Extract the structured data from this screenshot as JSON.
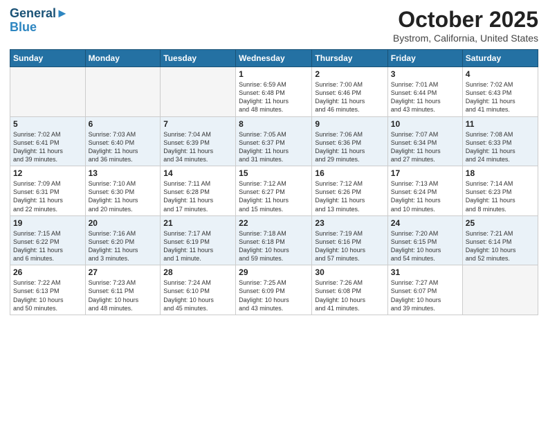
{
  "header": {
    "logo_line1": "General",
    "logo_line2": "Blue",
    "month_title": "October 2025",
    "location": "Bystrom, California, United States"
  },
  "days_of_week": [
    "Sunday",
    "Monday",
    "Tuesday",
    "Wednesday",
    "Thursday",
    "Friday",
    "Saturday"
  ],
  "weeks": [
    [
      {
        "day": "",
        "info": ""
      },
      {
        "day": "",
        "info": ""
      },
      {
        "day": "",
        "info": ""
      },
      {
        "day": "1",
        "info": "Sunrise: 6:59 AM\nSunset: 6:48 PM\nDaylight: 11 hours\nand 48 minutes."
      },
      {
        "day": "2",
        "info": "Sunrise: 7:00 AM\nSunset: 6:46 PM\nDaylight: 11 hours\nand 46 minutes."
      },
      {
        "day": "3",
        "info": "Sunrise: 7:01 AM\nSunset: 6:44 PM\nDaylight: 11 hours\nand 43 minutes."
      },
      {
        "day": "4",
        "info": "Sunrise: 7:02 AM\nSunset: 6:43 PM\nDaylight: 11 hours\nand 41 minutes."
      }
    ],
    [
      {
        "day": "5",
        "info": "Sunrise: 7:02 AM\nSunset: 6:41 PM\nDaylight: 11 hours\nand 39 minutes."
      },
      {
        "day": "6",
        "info": "Sunrise: 7:03 AM\nSunset: 6:40 PM\nDaylight: 11 hours\nand 36 minutes."
      },
      {
        "day": "7",
        "info": "Sunrise: 7:04 AM\nSunset: 6:39 PM\nDaylight: 11 hours\nand 34 minutes."
      },
      {
        "day": "8",
        "info": "Sunrise: 7:05 AM\nSunset: 6:37 PM\nDaylight: 11 hours\nand 31 minutes."
      },
      {
        "day": "9",
        "info": "Sunrise: 7:06 AM\nSunset: 6:36 PM\nDaylight: 11 hours\nand 29 minutes."
      },
      {
        "day": "10",
        "info": "Sunrise: 7:07 AM\nSunset: 6:34 PM\nDaylight: 11 hours\nand 27 minutes."
      },
      {
        "day": "11",
        "info": "Sunrise: 7:08 AM\nSunset: 6:33 PM\nDaylight: 11 hours\nand 24 minutes."
      }
    ],
    [
      {
        "day": "12",
        "info": "Sunrise: 7:09 AM\nSunset: 6:31 PM\nDaylight: 11 hours\nand 22 minutes."
      },
      {
        "day": "13",
        "info": "Sunrise: 7:10 AM\nSunset: 6:30 PM\nDaylight: 11 hours\nand 20 minutes."
      },
      {
        "day": "14",
        "info": "Sunrise: 7:11 AM\nSunset: 6:28 PM\nDaylight: 11 hours\nand 17 minutes."
      },
      {
        "day": "15",
        "info": "Sunrise: 7:12 AM\nSunset: 6:27 PM\nDaylight: 11 hours\nand 15 minutes."
      },
      {
        "day": "16",
        "info": "Sunrise: 7:12 AM\nSunset: 6:26 PM\nDaylight: 11 hours\nand 13 minutes."
      },
      {
        "day": "17",
        "info": "Sunrise: 7:13 AM\nSunset: 6:24 PM\nDaylight: 11 hours\nand 10 minutes."
      },
      {
        "day": "18",
        "info": "Sunrise: 7:14 AM\nSunset: 6:23 PM\nDaylight: 11 hours\nand 8 minutes."
      }
    ],
    [
      {
        "day": "19",
        "info": "Sunrise: 7:15 AM\nSunset: 6:22 PM\nDaylight: 11 hours\nand 6 minutes."
      },
      {
        "day": "20",
        "info": "Sunrise: 7:16 AM\nSunset: 6:20 PM\nDaylight: 11 hours\nand 3 minutes."
      },
      {
        "day": "21",
        "info": "Sunrise: 7:17 AM\nSunset: 6:19 PM\nDaylight: 11 hours\nand 1 minute."
      },
      {
        "day": "22",
        "info": "Sunrise: 7:18 AM\nSunset: 6:18 PM\nDaylight: 10 hours\nand 59 minutes."
      },
      {
        "day": "23",
        "info": "Sunrise: 7:19 AM\nSunset: 6:16 PM\nDaylight: 10 hours\nand 57 minutes."
      },
      {
        "day": "24",
        "info": "Sunrise: 7:20 AM\nSunset: 6:15 PM\nDaylight: 10 hours\nand 54 minutes."
      },
      {
        "day": "25",
        "info": "Sunrise: 7:21 AM\nSunset: 6:14 PM\nDaylight: 10 hours\nand 52 minutes."
      }
    ],
    [
      {
        "day": "26",
        "info": "Sunrise: 7:22 AM\nSunset: 6:13 PM\nDaylight: 10 hours\nand 50 minutes."
      },
      {
        "day": "27",
        "info": "Sunrise: 7:23 AM\nSunset: 6:11 PM\nDaylight: 10 hours\nand 48 minutes."
      },
      {
        "day": "28",
        "info": "Sunrise: 7:24 AM\nSunset: 6:10 PM\nDaylight: 10 hours\nand 45 minutes."
      },
      {
        "day": "29",
        "info": "Sunrise: 7:25 AM\nSunset: 6:09 PM\nDaylight: 10 hours\nand 43 minutes."
      },
      {
        "day": "30",
        "info": "Sunrise: 7:26 AM\nSunset: 6:08 PM\nDaylight: 10 hours\nand 41 minutes."
      },
      {
        "day": "31",
        "info": "Sunrise: 7:27 AM\nSunset: 6:07 PM\nDaylight: 10 hours\nand 39 minutes."
      },
      {
        "day": "",
        "info": ""
      }
    ]
  ]
}
